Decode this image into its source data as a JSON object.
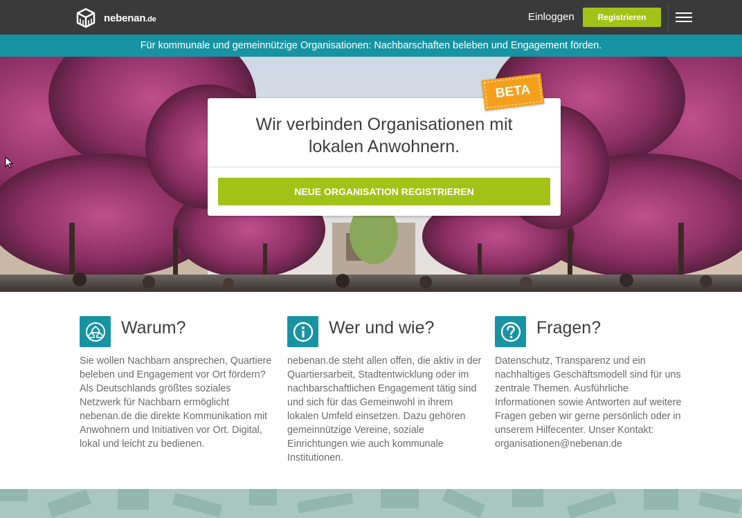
{
  "nav": {
    "logo_name": "nebenan",
    "logo_tld": ".de",
    "login_label": "Einloggen",
    "register_label": "Registrieren",
    "menu_icon": "hamburger-menu-icon"
  },
  "banner": {
    "text": "Für kommunale und gemeinnützige Organisationen: Nachbarschaften beleben und Engagement förden."
  },
  "hero": {
    "badge": "BETA",
    "title": "Wir verbinden Organisationen mit lokalen Anwohnern.",
    "cta_label": "NEUE ORGANISATION REGISTRIEREN"
  },
  "columns": [
    {
      "icon": "neighbors-icon",
      "heading": "Warum?",
      "text": "Sie wollen Nachbarn ansprechen, Quartiere beleben und Engagement vor Ort fördern? Als Deutschlands größtes soziales Netzwerk für Nachbarn ermöglicht nebenan.de die direkte Kommunikation mit Anwohnern und Initiativen vor Ort. Digital, lokal und leicht zu bedienen."
    },
    {
      "icon": "info-icon",
      "heading": "Wer und wie?",
      "text": "nebenan.de steht allen offen, die aktiv in der Quartiersarbeit, Stadtentwicklung oder im nachbarschaftlichen Engagement tätig sind und sich für das Gemeinwohl in ihrem lokalen Umfeld einsetzen. Dazu gehören gemeinnützige Vereine, soziale Einrichtungen wie auch kommunale Institutionen."
    },
    {
      "icon": "question-icon",
      "heading": "Fragen?",
      "text": "Datenschutz, Transparenz und ein nachhaltiges Geschäftsmodell sind für uns zentrale Themen. Ausführliche Informationen sowie Antworten auf weitere Fragen geben wir gerne persönlich oder in unserem Hilfecenter. Unser Kontakt: organisationen@nebenan.de"
    }
  ],
  "colors": {
    "nav_bg": "#3a3a3a",
    "accent_green": "#a3c217",
    "teal": "#1793a3",
    "beta_orange": "#f4a01c"
  }
}
